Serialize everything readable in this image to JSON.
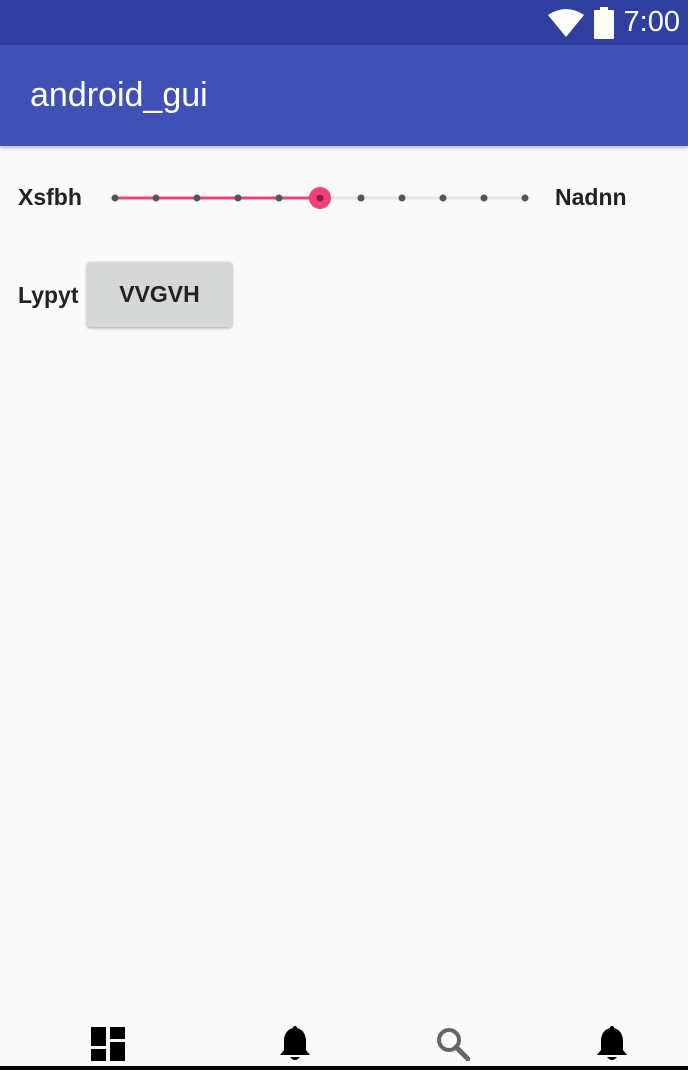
{
  "status_bar": {
    "time": "7:00",
    "icons": [
      "wifi-icon",
      "battery-icon"
    ]
  },
  "app_bar": {
    "title": "android_gui"
  },
  "slider_row": {
    "label_left": "Xsfbh",
    "label_right": "Nadnn",
    "step_count": 10,
    "selected_step": 5,
    "active_color": "#f0407a",
    "track_color": "#e6e6e6",
    "tick_color": "#555555"
  },
  "button_row": {
    "label": "Lypyt",
    "button_label": "VVGVH"
  },
  "bottom_nav": {
    "items": [
      {
        "icon": "dashboard-icon"
      },
      {
        "icon": "bell-icon"
      },
      {
        "icon": "search-icon"
      },
      {
        "icon": "bell-icon"
      }
    ]
  },
  "colors": {
    "status_bar": "#303f9f",
    "app_bar": "#3f51b5",
    "background": "#fafafa"
  }
}
